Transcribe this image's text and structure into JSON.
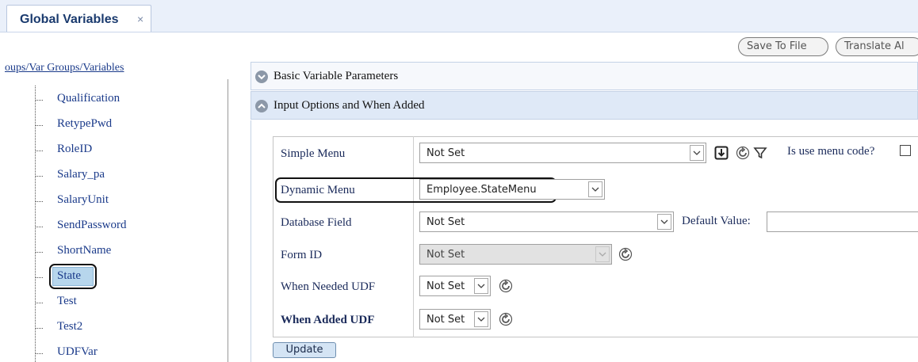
{
  "tab": {
    "label": "Global Variables",
    "close": "×"
  },
  "toolbar": {
    "save_label": "Save To File",
    "translate_label": "Translate Al"
  },
  "tree": {
    "header": "oups/Var Groups/Variables",
    "items": [
      "Qualification",
      "RetypePwd",
      "RoleID",
      "Salary_pa",
      "SalaryUnit",
      "SendPassword",
      "ShortName",
      "State",
      "Test",
      "Test2",
      "UDFVar"
    ],
    "selected": "State"
  },
  "sections": {
    "basic": {
      "label": "Basic Variable Parameters",
      "state": "collapsed"
    },
    "input": {
      "label": "Input Options and When Added",
      "state": "expanded"
    }
  },
  "form": {
    "simple_menu": {
      "label": "Simple Menu",
      "value": "Not Set"
    },
    "use_menu_code_label": "Is use menu code?",
    "dynamic_menu": {
      "label": "Dynamic Menu",
      "value": "Employee.StateMenu"
    },
    "database_field": {
      "label": "Database Field",
      "value": "Not Set"
    },
    "default_value_label": "Default Value:",
    "default_value": "",
    "form_id": {
      "label": "Form ID",
      "value": "Not Set"
    },
    "when_needed_udf": {
      "label": "When Needed UDF",
      "value": "Not Set"
    },
    "when_added_udf": {
      "label": "When Added UDF",
      "value": "Not Set"
    },
    "update_label": "Update"
  },
  "icons": {
    "download": "download-icon",
    "refresh": "refresh-icon",
    "filter": "filter-icon",
    "expand": "chevron-down-circle-icon",
    "collapse": "chevron-up-circle-icon"
  }
}
